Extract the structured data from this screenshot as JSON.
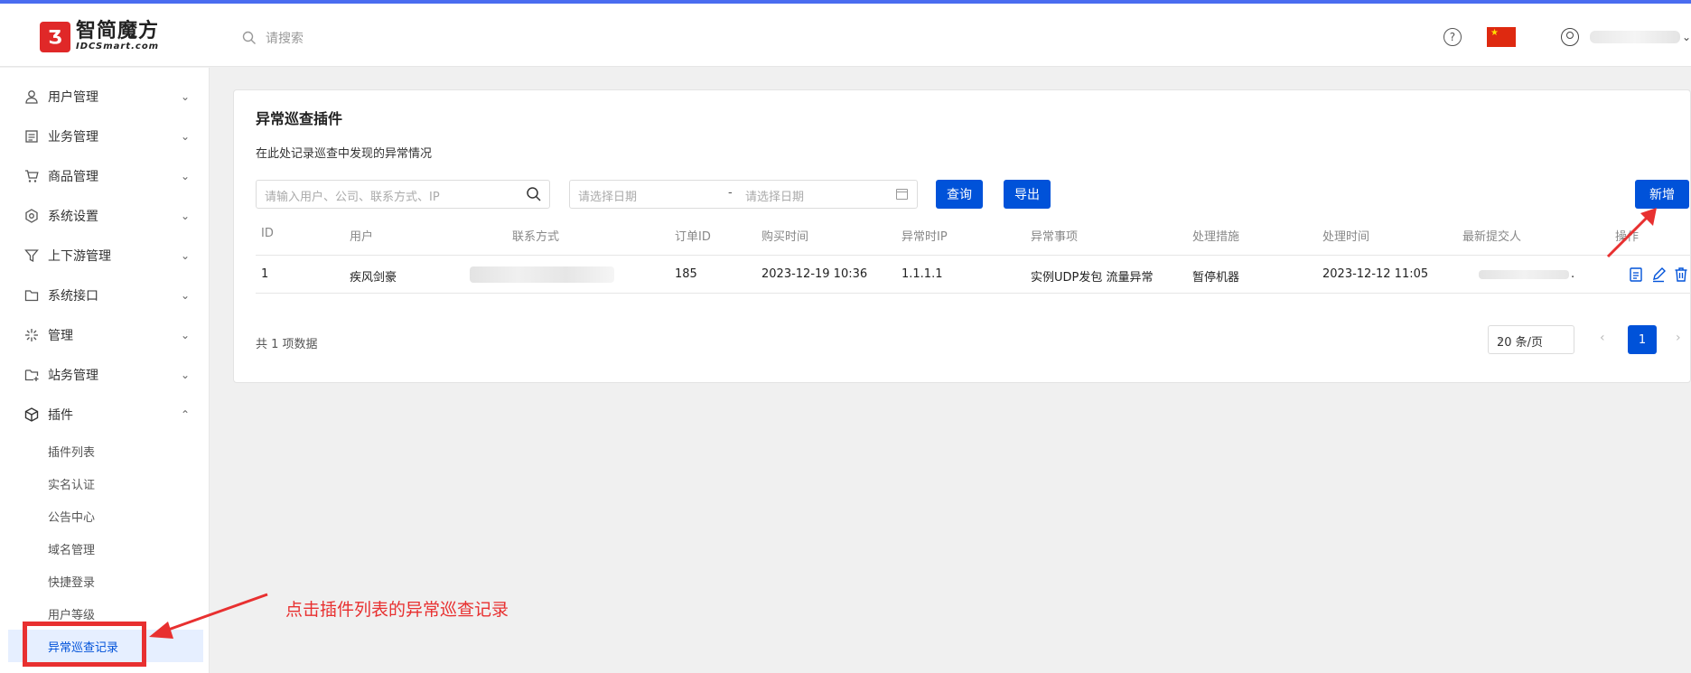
{
  "header": {
    "logo_mark": "Ʒ",
    "logo_cn": "智简魔方",
    "logo_en": "IDCSmart.com",
    "search_placeholder": "请搜索",
    "help_icon": "?",
    "user_caret": "⌄"
  },
  "sidebar": {
    "items": [
      {
        "label": "用户管理",
        "icon": "user-icon"
      },
      {
        "label": "业务管理",
        "icon": "document-icon"
      },
      {
        "label": "商品管理",
        "icon": "cart-icon"
      },
      {
        "label": "系统设置",
        "icon": "hexagon-gear-icon"
      },
      {
        "label": "上下游管理",
        "icon": "filter-icon"
      },
      {
        "label": "系统接口",
        "icon": "folder-icon"
      },
      {
        "label": "管理",
        "icon": "sparkle-icon"
      },
      {
        "label": "站务管理",
        "icon": "folder-plus-icon"
      },
      {
        "label": "插件",
        "icon": "cube-icon"
      }
    ],
    "plugin_sub": [
      "插件列表",
      "实名认证",
      "公告中心",
      "域名管理",
      "快捷登录",
      "用户等级",
      "异常巡查记录"
    ],
    "chevron_down": "⌄",
    "chevron_up": "⌃"
  },
  "main": {
    "title": "异常巡查插件",
    "description": "在此处记录巡查中发现的异常情况",
    "keyword_placeholder": "请输入用户、公司、联系方式、IP",
    "date_start_placeholder": "请选择日期",
    "date_sep": "-",
    "date_end_placeholder": "请选择日期",
    "query_button": "查询",
    "export_button": "导出",
    "add_button": "新增",
    "columns": [
      "ID",
      "用户",
      "联系方式",
      "订单ID",
      "购买时间",
      "异常时IP",
      "异常事项",
      "处理措施",
      "处理时间",
      "最新提交人",
      "操作"
    ],
    "rows": [
      {
        "id": "1",
        "user": "疾风剑豪",
        "order_id": "185",
        "purchase_time": "2023-12-19 10:36",
        "ip": "1.1.1.1",
        "issue": "实例UDP发包 流量异常",
        "action": "暂停机器",
        "handle_time": "2023-12-12 11:05",
        "trailing": "."
      }
    ],
    "total_text": "共 1 项数据",
    "page_size": "20 条/页",
    "page_size_caret": "⌄",
    "prev": "‹",
    "current_page": "1",
    "next": "›"
  },
  "annotation": {
    "text": "点击插件列表的异常巡查记录",
    "color": "#e83030"
  },
  "colors": {
    "primary": "#0052d9",
    "accent_topline": "#4a6cf0",
    "active_bg": "#e6efff"
  }
}
